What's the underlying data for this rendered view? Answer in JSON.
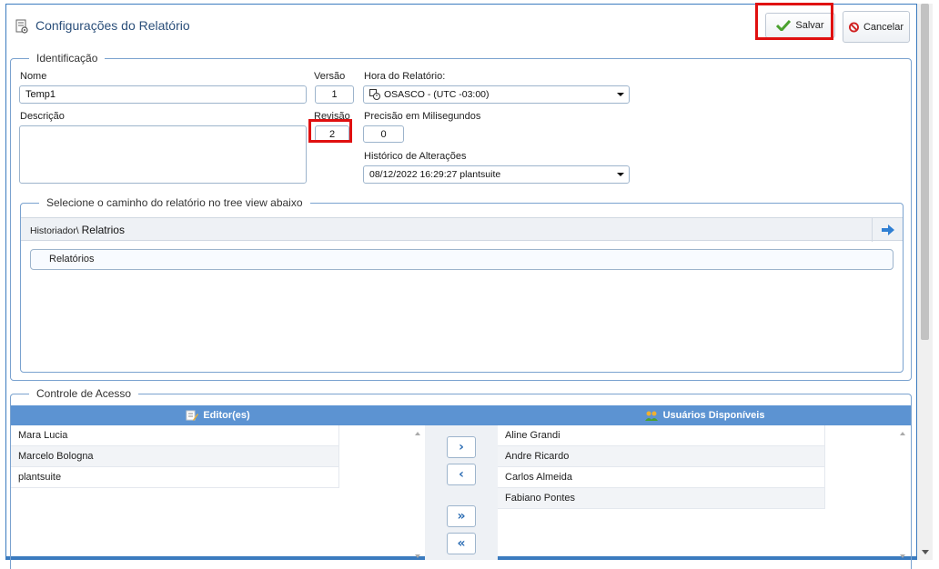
{
  "header": {
    "title": "Configurações do Relatório",
    "save_label": "Salvar",
    "cancel_label": "Cancelar"
  },
  "identification": {
    "legend": "Identificação",
    "name_label": "Nome",
    "name_value": "Temp1",
    "description_label": "Descrição",
    "description_value": "",
    "version_label": "Versão",
    "version_value": "1",
    "revision_label": "Revisão",
    "revision_value": "2",
    "report_time_label": "Hora do Relatório:",
    "report_time_value": "OSASCO - (UTC -03:00)",
    "precision_label": "Precisão em Milisegundos",
    "precision_value": "0",
    "history_label": "Histórico de Alterações",
    "history_value": "08/12/2022 16:29:27 plantsuite"
  },
  "tree": {
    "legend": "Selecione o caminho do relatório no tree view abaixo",
    "path_prefix": "Historiador\\",
    "path_current": "Relatrios",
    "node_label": "Relatórios"
  },
  "access": {
    "legend": "Controle de Acesso",
    "editors_header": "Editor(es)",
    "available_header": "Usuários Disponíveis",
    "editors": [
      "Mara Lucia",
      "Marcelo Bologna",
      "plantsuite"
    ],
    "available": [
      "Aline Grandi",
      "Andre Ricardo",
      "Carlos Almeida",
      "Fabiano Pontes"
    ],
    "move_right": "›",
    "move_left": "‹",
    "move_all_right": "»",
    "move_all_left": "«"
  },
  "colors": {
    "accent": "#3b7bbf",
    "header_bar": "#5c93d2",
    "highlight": "#e01010"
  }
}
